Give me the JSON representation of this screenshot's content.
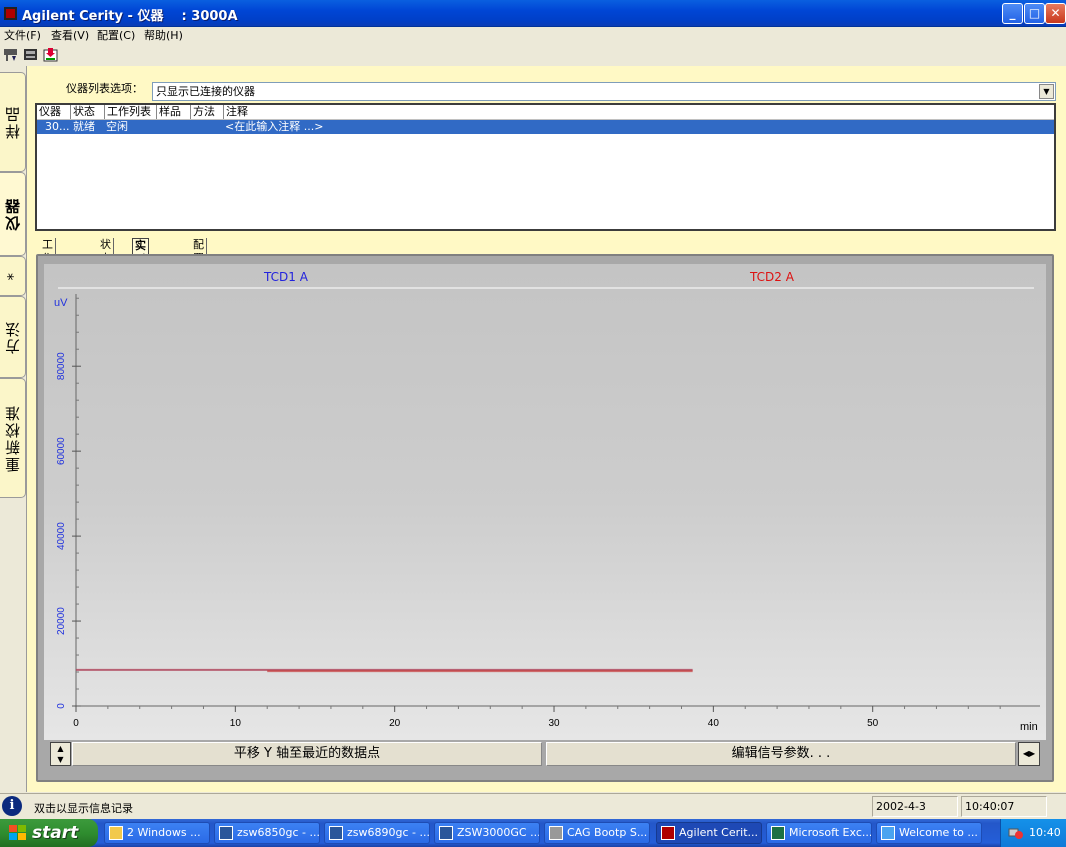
{
  "window": {
    "title": "Agilent Cerity - 仪器    : 3000A"
  },
  "menu": [
    "文件(F)",
    "查看(V)",
    "配置(C)",
    "帮助(H)"
  ],
  "side_tabs": [
    {
      "label": "样品",
      "active": false
    },
    {
      "label": "仪器",
      "active": true
    },
    {
      "label": "*",
      "active": false
    },
    {
      "label": "方法",
      "active": false
    },
    {
      "label": "重新校准",
      "active": false
    }
  ],
  "instrument_options": {
    "label": "仪器列表选项：",
    "value": "只显示已连接的仪器"
  },
  "instrument_list": {
    "columns": [
      "仪器",
      "状态",
      "工作列表",
      "样品",
      "方法",
      "注释"
    ],
    "rows": [
      [
        "30...",
        "就绪",
        "空闲",
        "",
        "",
        "<在此输入注释 ...>"
      ]
    ]
  },
  "sub_tabs": [
    {
      "label": "工作列表",
      "active": false
    },
    {
      "label": "状态",
      "active": false
    },
    {
      "label": "实时绘图",
      "active": true
    },
    {
      "label": "配置",
      "active": false
    }
  ],
  "chart_data": {
    "type": "line",
    "series": [
      {
        "name": "TCD1 A",
        "color": "#0000ff",
        "x": [
          0,
          38.7
        ],
        "y": [
          8500,
          8500
        ]
      },
      {
        "name": "TCD2 A",
        "color": "#dd0000",
        "x": [
          12,
          38.7
        ],
        "y": [
          8200,
          8200
        ]
      }
    ],
    "xlabel": "min",
    "ylabel": "uV",
    "x_ticks": [
      0,
      10,
      20,
      30,
      40,
      50
    ],
    "y_ticks": [
      0,
      20000,
      40000,
      60000,
      80000
    ],
    "xlim": [
      0,
      60.5
    ],
    "ylim": [
      0,
      97000
    ],
    "grid": false
  },
  "plot_buttons": {
    "pan": "平移 Y 轴至最近的数据点",
    "edit": "编辑信号参数. . ."
  },
  "status": {
    "message": "双击以显示信息记录",
    "date": "2002-4-3",
    "time": "10:40:07"
  },
  "taskbar": {
    "start": "start",
    "items": [
      {
        "label": "2 Windows ...",
        "icon": "folder-icon",
        "active": false
      },
      {
        "label": "zsw6850gc - ...",
        "icon": "word-icon",
        "active": false
      },
      {
        "label": "zsw6890gc - ...",
        "icon": "word-icon",
        "active": false
      },
      {
        "label": "ZSW3000GC ...",
        "icon": "word-icon",
        "active": false
      },
      {
        "label": "CAG Bootp S...",
        "icon": "app-icon",
        "active": false
      },
      {
        "label": "Agilent Cerit...",
        "icon": "cerity-icon",
        "active": true
      },
      {
        "label": "Microsoft Exc...",
        "icon": "excel-icon",
        "active": false
      },
      {
        "label": "Welcome to ...",
        "icon": "ie-icon",
        "active": false
      }
    ],
    "clock": "10:40"
  }
}
